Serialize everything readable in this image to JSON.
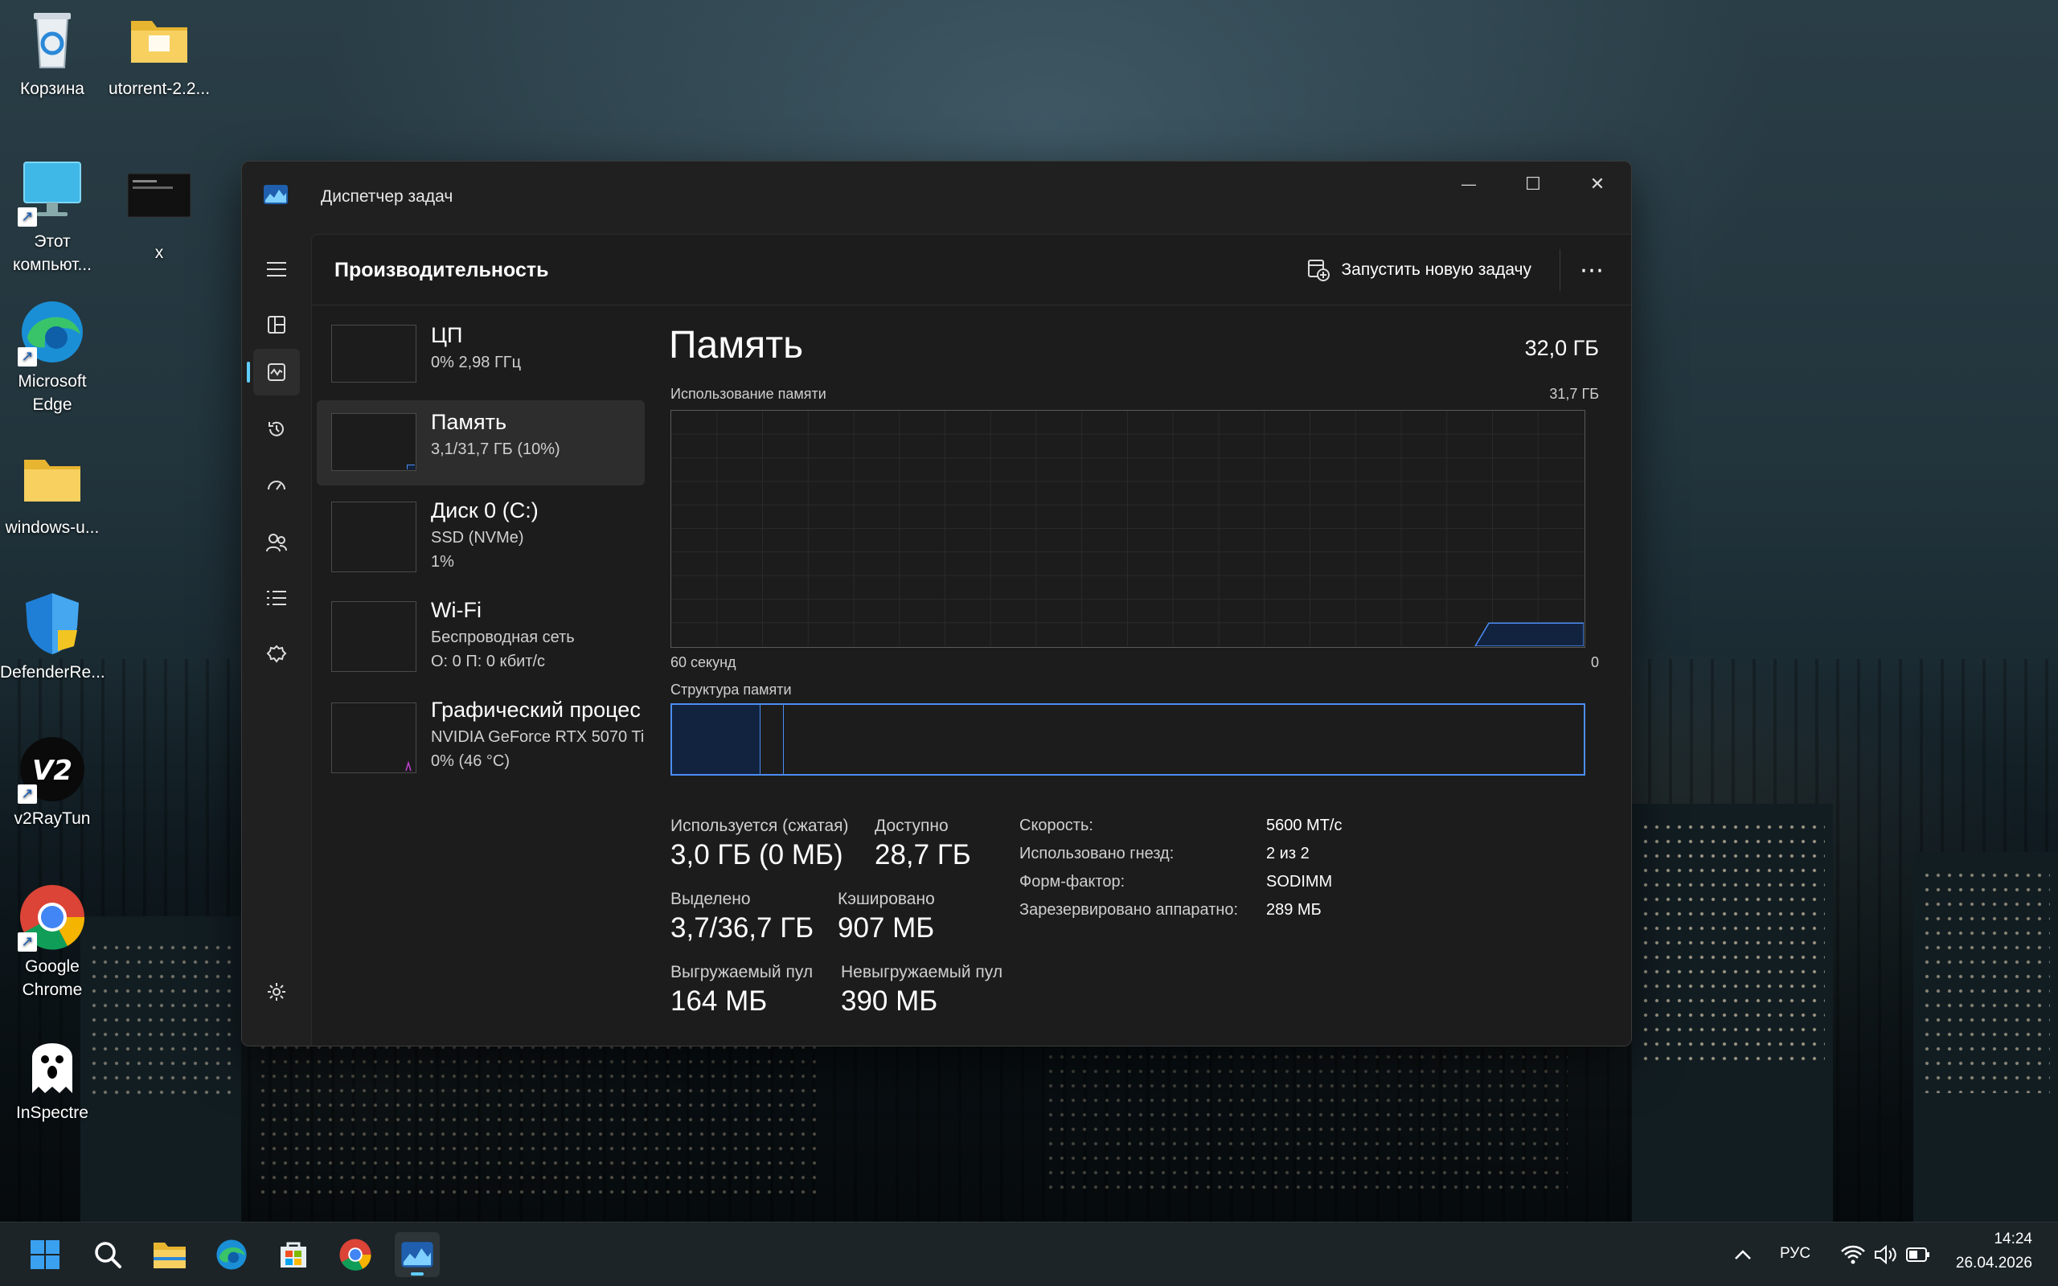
{
  "desktop": {
    "icons": [
      {
        "label": "Корзина"
      },
      {
        "label": "utorrent-2.2..."
      },
      {
        "label": "Этот компьют..."
      },
      {
        "label": "x"
      },
      {
        "label": "Microsoft Edge"
      },
      {
        "label": "windows-u..."
      },
      {
        "label": "DefenderRe..."
      },
      {
        "label": "v2RayTun"
      },
      {
        "label": "Google Chrome"
      },
      {
        "label": "InSpectre"
      }
    ]
  },
  "window": {
    "title": "Диспетчер задач",
    "page_title": "Производительность",
    "run_new_task": "Запустить новую задачу",
    "more": "⋯",
    "controls": {
      "minimize": "—",
      "maximize": "☐",
      "close": "✕"
    }
  },
  "resources": [
    {
      "name": "ЦП",
      "sub1": "0%  2,98 ГГц",
      "sub2": ""
    },
    {
      "name": "Память",
      "sub1": "3,1/31,7 ГБ (10%)",
      "sub2": ""
    },
    {
      "name": "Диск 0 (C:)",
      "sub1": "SSD (NVMe)",
      "sub2": "1%"
    },
    {
      "name": "Wi-Fi",
      "sub1": "Беспроводная сеть",
      "sub2": "О: 0  П: 0 кбит/с"
    },
    {
      "name": "Графический процес",
      "sub1": "NVIDIA GeForce RTX 5070 Ti",
      "sub2": "0%  (46 °C)"
    }
  ],
  "memory": {
    "title": "Память",
    "total": "32,0 ГБ",
    "usage_label": "Использование памяти",
    "usage_max": "31,7 ГБ",
    "time_left": "60 секунд",
    "time_right": "0",
    "composition_label": "Структура памяти",
    "usage_fraction": 0.098,
    "composition": {
      "in_use_fraction": 0.097,
      "modified_fraction": 0.026
    },
    "stats": {
      "in_use_label": "Используется (сжатая)",
      "in_use_value": "3,0 ГБ (0 МБ)",
      "available_label": "Доступно",
      "available_value": "28,7 ГБ",
      "committed_label": "Выделено",
      "committed_value": "3,7/36,7 ГБ",
      "cached_label": "Кэшировано",
      "cached_value": "907 МБ",
      "paged_label": "Выгружаемый пул",
      "paged_value": "164 МБ",
      "nonpaged_label": "Невыгружаемый пул",
      "nonpaged_value": "390 МБ"
    },
    "specs": [
      {
        "key": "Скорость:",
        "value": "5600 МТ/с"
      },
      {
        "key": "Использовано гнезд:",
        "value": "2 из 2"
      },
      {
        "key": "Форм-фактор:",
        "value": "SODIMM"
      },
      {
        "key": "Зарезервировано аппаратно:",
        "value": "289 МБ"
      }
    ]
  },
  "taskbar": {
    "language": "РУС",
    "time": "14:24",
    "date": "26.04.2026"
  },
  "colors": {
    "accent": "#60cdff",
    "memory_blue": "#4c8df6",
    "memory_fill": "#12233f"
  }
}
